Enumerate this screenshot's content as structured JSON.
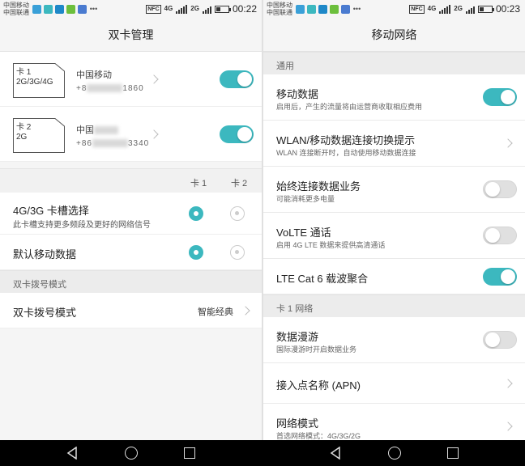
{
  "status": {
    "left": {
      "carrier_line1": "中国移动",
      "carrier_line2": "中国联通",
      "nfc": "NFC",
      "network": "4G",
      "network2": "2G",
      "time": "00:22"
    },
    "right": {
      "carrier_line1": "中国移动",
      "carrier_line2": "中国联通",
      "nfc": "NFC",
      "network": "4G",
      "network2": "2G",
      "time": "00:23"
    }
  },
  "left": {
    "title": "双卡管理",
    "sims": [
      {
        "card_label": "卡 1",
        "card_type": "2G/3G/4G",
        "carrier": "中国移动",
        "number_prefix": "+8",
        "number_suffix": "1860",
        "enabled": true
      },
      {
        "card_label": "卡 2",
        "card_type": "2G",
        "carrier": "中国",
        "number_prefix": "+86",
        "number_suffix": "3340",
        "enabled": true
      }
    ],
    "columns": {
      "card1": "卡 1",
      "card2": "卡 2"
    },
    "options": [
      {
        "title": "4G/3G 卡槽选择",
        "subtitle": "此卡槽支持更多频段及更好的网络信号",
        "selected": "card1"
      },
      {
        "title": "默认移动数据",
        "subtitle": "",
        "selected": "card1"
      }
    ],
    "dial_section": "双卡拨号模式",
    "dial_row": {
      "title": "双卡拨号模式",
      "value": "智能经典"
    }
  },
  "right": {
    "title": "移动网络",
    "section_general": "通用",
    "rows_general": [
      {
        "title": "移动数据",
        "subtitle": "启用后，产生的流量将由运营商收取相应费用",
        "control": "toggle",
        "on": true
      },
      {
        "title": "WLAN/移动数据连接切换提示",
        "subtitle": "WLAN 连接断开时，自动使用移动数据连接",
        "control": "chevron"
      },
      {
        "title": "始终连接数据业务",
        "subtitle": "可能消耗更多电量",
        "control": "toggle",
        "on": false
      },
      {
        "title": "VoLTE 通话",
        "subtitle": "启用 4G LTE 数据来提供高清通话",
        "control": "toggle",
        "on": false
      },
      {
        "title": "LTE Cat 6 载波聚合",
        "subtitle": "",
        "control": "toggle",
        "on": true
      }
    ],
    "section_card1": "卡 1 网络",
    "rows_card1": [
      {
        "title": "数据漫游",
        "subtitle": "国际漫游时开启数据业务",
        "control": "toggle",
        "on": false
      },
      {
        "title": "接入点名称 (APN)",
        "subtitle": "",
        "control": "chevron"
      },
      {
        "title": "网络模式",
        "subtitle": "首选网络模式：4G/3G/2G",
        "control": "chevron"
      }
    ]
  },
  "colors": {
    "accent": "#3cb8bf",
    "background": "#f5f5f5",
    "navbar": "#000000"
  }
}
